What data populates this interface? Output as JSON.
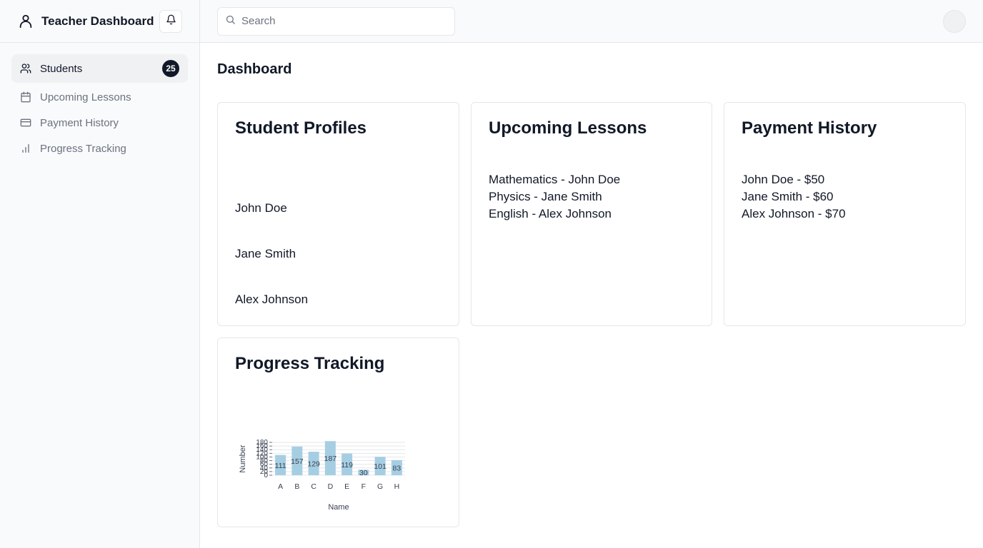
{
  "app": {
    "title": "Teacher Dashboard"
  },
  "icons": {
    "brand": "user-icon",
    "bell": "bell-icon",
    "search": "search-icon"
  },
  "sidebar": {
    "items": [
      {
        "label": "Students",
        "icon": "users-icon",
        "badge": "25",
        "active": true
      },
      {
        "label": "Upcoming Lessons",
        "icon": "calendar-icon"
      },
      {
        "label": "Payment History",
        "icon": "credit-card-icon"
      },
      {
        "label": "Progress Tracking",
        "icon": "bar-chart-icon"
      }
    ]
  },
  "topbar": {
    "search_placeholder": "Search"
  },
  "page": {
    "title": "Dashboard"
  },
  "cards": {
    "profiles": {
      "title": "Student Profiles",
      "items": [
        "John Doe",
        "Jane Smith",
        "Alex Johnson"
      ]
    },
    "lessons": {
      "title": "Upcoming Lessons",
      "items": [
        "Mathematics - John Doe",
        "Physics - Jane Smith",
        "English - Alex Johnson"
      ]
    },
    "payments": {
      "title": "Payment History",
      "items": [
        "John Doe - $50",
        "Jane Smith - $60",
        "Alex Johnson - $70"
      ]
    },
    "progress": {
      "title": "Progress Tracking"
    }
  },
  "chart_data": {
    "type": "bar",
    "categories": [
      "A",
      "B",
      "C",
      "D",
      "E",
      "F",
      "G",
      "H"
    ],
    "values": [
      111,
      157,
      129,
      187,
      119,
      30,
      101,
      83
    ],
    "xlabel": "Name",
    "ylabel": "Number",
    "ylim": [
      0,
      180
    ],
    "yticks": [
      0,
      20,
      40,
      60,
      80,
      100,
      120,
      140,
      160,
      180
    ],
    "bar_color": "#a6cee3",
    "grid": true
  }
}
